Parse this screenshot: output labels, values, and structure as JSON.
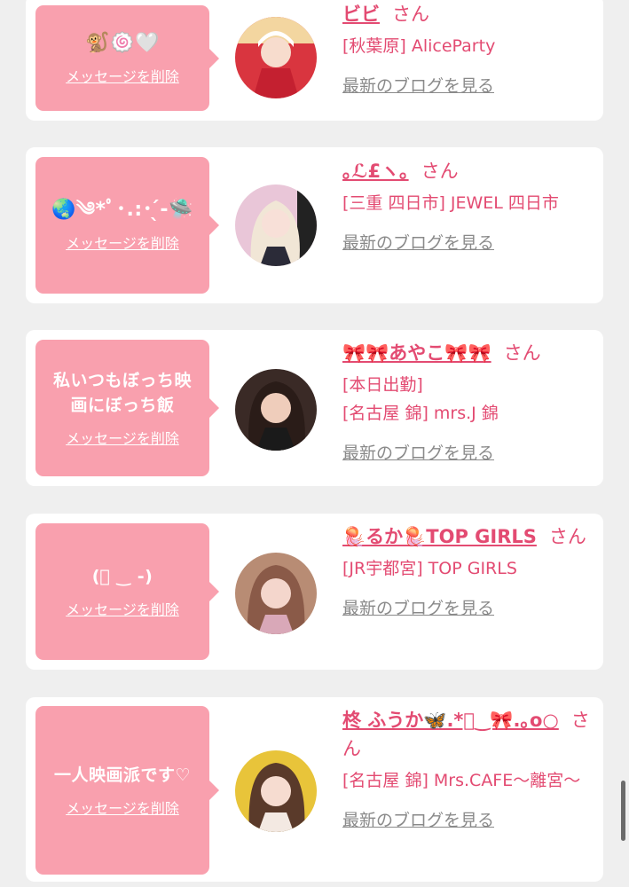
{
  "colors": {
    "page_bg": "#efefef",
    "card_bg": "#ffffff",
    "bubble_pink": "#f9a0ae",
    "accent_pink": "#e34b72",
    "link_gray": "#8a8a8a"
  },
  "cards": [
    {
      "message": "🐒🍥🤍",
      "delete_label": "メッセージを削除",
      "name": "ビビ",
      "honorific": "さん",
      "lines": [
        "[秋葉原] AliceParty"
      ],
      "blog_label": "最新のブログを見る",
      "avatar_icon": "avatar-photo"
    },
    {
      "message": "🌏༄*ﾟ･.:･ ̖́-🛸",
      "delete_label": "メッセージを削除",
      "name": "｡ℒ£ヽ｡",
      "honorific": "さん",
      "lines": [
        "[三重 四日市] JEWEL 四日市"
      ],
      "blog_label": "最新のブログを見る",
      "avatar_icon": "avatar-photo"
    },
    {
      "message": "私いつもぼっち映画にぼっち飯",
      "delete_label": "メッセージを削除",
      "name": "🎀🎀あやこ🎀🎀",
      "honorific": "さん",
      "lines": [
        "[本日出勤]",
        "[名古屋 錦] mrs.J 錦"
      ],
      "blog_label": "最新のブログを見る",
      "avatar_icon": "avatar-photo"
    },
    {
      "message": "(ﾟ ‿ -)",
      "delete_label": "メッセージを削除",
      "name": "🪼るか🪼TOP GIRLS",
      "honorific": "さん",
      "lines": [
        "[JR宇都宮] TOP GIRLS"
      ],
      "blog_label": "最新のブログを見る",
      "avatar_icon": "avatar-photo"
    },
    {
      "message": "一人映画派です♡",
      "delete_label": "メッセージを削除",
      "name": "柊 ふうか🦋.*ﾟ‿🎀.｡o○",
      "honorific": "さん",
      "lines": [
        "[名古屋 錦] Mrs.CAFE〜離宮〜"
      ],
      "blog_label": "最新のブログを見る",
      "avatar_icon": "avatar-photo"
    }
  ]
}
